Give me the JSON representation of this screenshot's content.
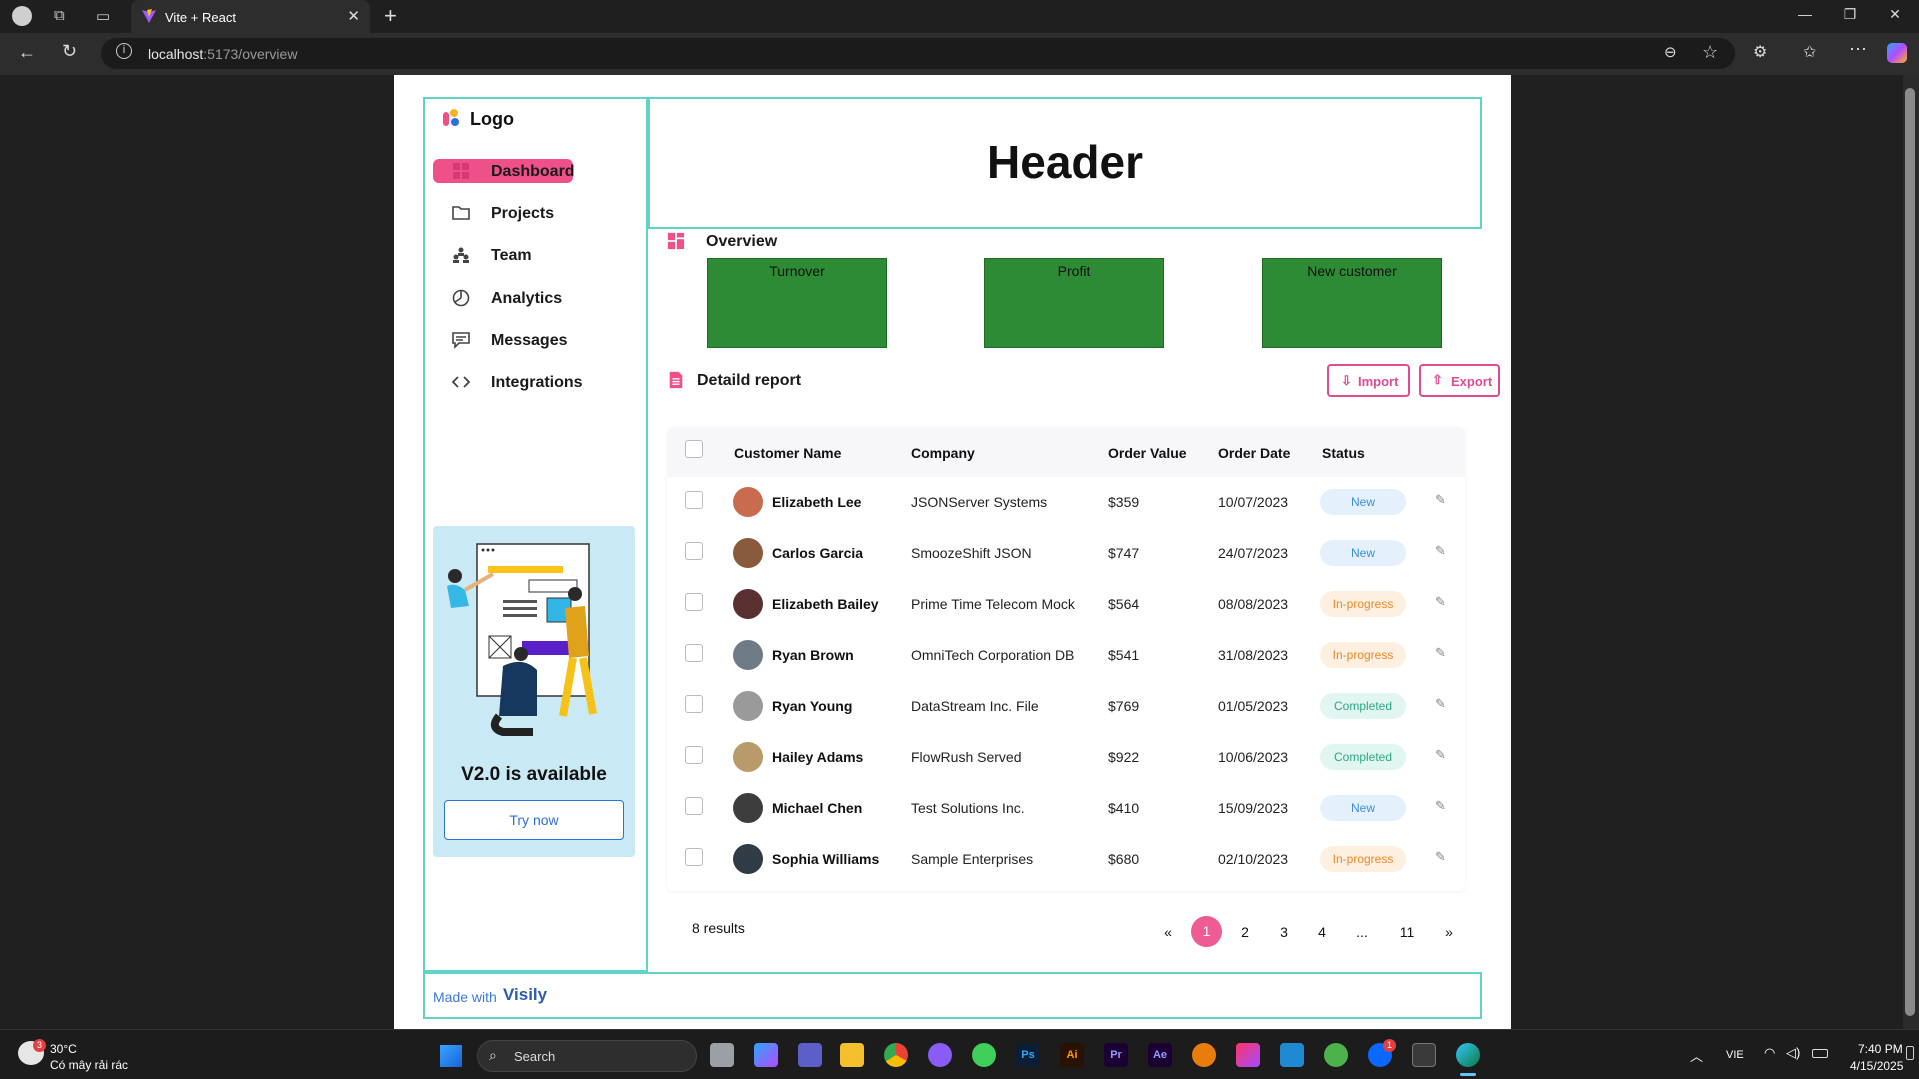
{
  "browser": {
    "tab_title": "Vite + React",
    "url_host": "localhost",
    "url_path": ":5173/overview",
    "new_tab": "+",
    "tab_close": "✕"
  },
  "sidebar": {
    "logo": "Logo",
    "items": [
      {
        "label": "Dashboard",
        "icon": "grid-icon",
        "active": true
      },
      {
        "label": "Projects",
        "icon": "folder-icon"
      },
      {
        "label": "Team",
        "icon": "team-icon"
      },
      {
        "label": "Analytics",
        "icon": "pie-chart-icon"
      },
      {
        "label": "Messages",
        "icon": "message-icon"
      },
      {
        "label": "Integrations",
        "icon": "code-icon"
      }
    ],
    "promo": {
      "title": "V2.0 is available",
      "button": "Try now"
    }
  },
  "header": {
    "title": "Header"
  },
  "overview": {
    "title": "Overview",
    "cards": [
      {
        "label": "Turnover"
      },
      {
        "label": "Profit"
      },
      {
        "label": "New customer"
      }
    ],
    "card_color": "#2e8b35"
  },
  "report": {
    "title": "Detaild report",
    "import_label": "Import",
    "export_label": "Export",
    "columns": [
      "Customer Name",
      "Company",
      "Order Value",
      "Order Date",
      "Status"
    ],
    "rows": [
      {
        "name": "Elizabeth Lee",
        "company": "JSONServer Systems",
        "value": "$359",
        "date": "10/07/2023",
        "status": "New"
      },
      {
        "name": "Carlos Garcia",
        "company": "SmoozeShift JSON",
        "value": "$747",
        "date": "24/07/2023",
        "status": "New"
      },
      {
        "name": "Elizabeth Bailey",
        "company": "Prime Time Telecom Mock",
        "value": "$564",
        "date": "08/08/2023",
        "status": "In-progress"
      },
      {
        "name": "Ryan Brown",
        "company": "OmniTech Corporation DB",
        "value": "$541",
        "date": "31/08/2023",
        "status": "In-progress"
      },
      {
        "name": "Ryan Young",
        "company": "DataStream Inc. File",
        "value": "$769",
        "date": "01/05/2023",
        "status": "Completed"
      },
      {
        "name": "Hailey Adams",
        "company": "FlowRush Served",
        "value": "$922",
        "date": "10/06/2023",
        "status": "Completed"
      },
      {
        "name": "Michael Chen",
        "company": "Test Solutions Inc.",
        "value": "$410",
        "date": "15/09/2023",
        "status": "New"
      },
      {
        "name": "Sophia Williams",
        "company": "Sample Enterprises",
        "value": "$680",
        "date": "02/10/2023",
        "status": "In-progress"
      }
    ],
    "results": "8 results",
    "pagination": [
      "«",
      "1",
      "2",
      "3",
      "4",
      "...",
      "11",
      "»"
    ],
    "current_page": "1"
  },
  "footer": {
    "made_with": "Made with",
    "brand": "Visily"
  },
  "taskbar": {
    "weather_temp": "30°C",
    "weather_desc": "Có mây rải rác",
    "weather_badge": "3",
    "search": "Search",
    "lang": "VIE",
    "time": "7:40 PM",
    "date": "4/15/2025",
    "app_labels": {
      "ps": "Ps",
      "ai": "Ai",
      "pr": "Pr",
      "ae": "Ae"
    },
    "notif_count": "1"
  },
  "colors": {
    "accent": "#f0508a",
    "border": "#5fd3c7",
    "link": "#2f6fd8"
  }
}
